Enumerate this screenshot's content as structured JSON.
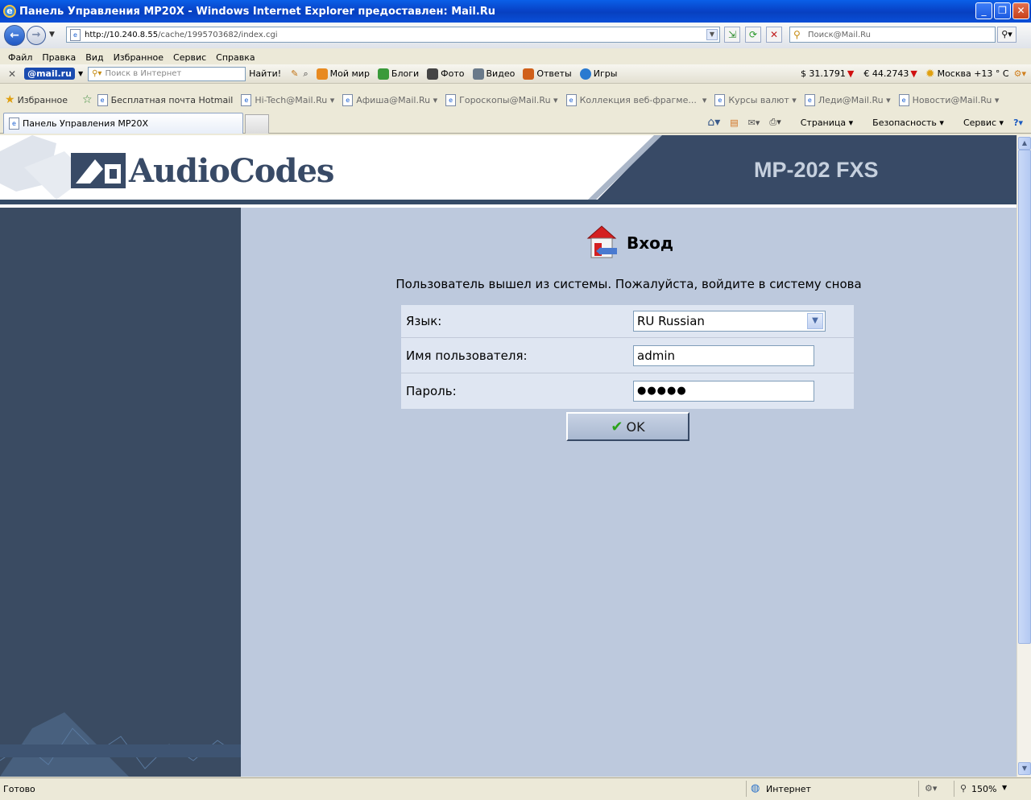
{
  "window": {
    "title": "Панель Управления MP20X - Windows Internet Explorer предоставлен: Mail.Ru"
  },
  "address": {
    "host": "http://10.240.8.55",
    "path": "/cache/1995703682/index.cgi"
  },
  "search": {
    "placeholder": "Поиск@Mail.Ru"
  },
  "menu": [
    "Файл",
    "Правка",
    "Вид",
    "Избранное",
    "Сервис",
    "Справка"
  ],
  "mailbar": {
    "logo": "@mail.ru",
    "search_placeholder": "Поиск в Интернет",
    "find": "Найти!",
    "items": [
      "Мой мир",
      "Блоги",
      "Фото",
      "Видео",
      "Ответы",
      "Игры"
    ],
    "usd": "$ 31.1791",
    "eur": "€ 44.2743",
    "weather": "Москва +13 ° C"
  },
  "favorites": {
    "label": "Избранное",
    "items": [
      "Бесплатная почта Hotmail",
      "Hi-Tech@Mail.Ru",
      "Афиша@Mail.Ru",
      "Гороскопы@Mail.Ru",
      "Коллекция веб-фрагме...",
      "Курсы валют",
      "Леди@Mail.Ru",
      "Новости@Mail.Ru"
    ]
  },
  "tab": {
    "title": "Панель Управления MP20X"
  },
  "commands": {
    "page": "Страница",
    "security": "Безопасность",
    "tools": "Сервис"
  },
  "banner": {
    "logo": "AudioCodes",
    "model": "MP-202 FXS"
  },
  "login": {
    "title": "Вход",
    "message": "Пользователь вышел из системы. Пожалуйста, войдите в систему снова",
    "language_label": "Язык:",
    "language_value": "RU Russian",
    "username_label": "Имя пользователя:",
    "username_value": "admin",
    "password_label": "Пароль:",
    "password_value": "●●●●●",
    "ok": "OK"
  },
  "status": {
    "left": "Готово",
    "zone": "Интернет",
    "zoom": "150%"
  },
  "colors": {
    "accent": "#0a4fd8",
    "sidebar": "#3a4b62",
    "content_bg": "#bdc9dd"
  }
}
